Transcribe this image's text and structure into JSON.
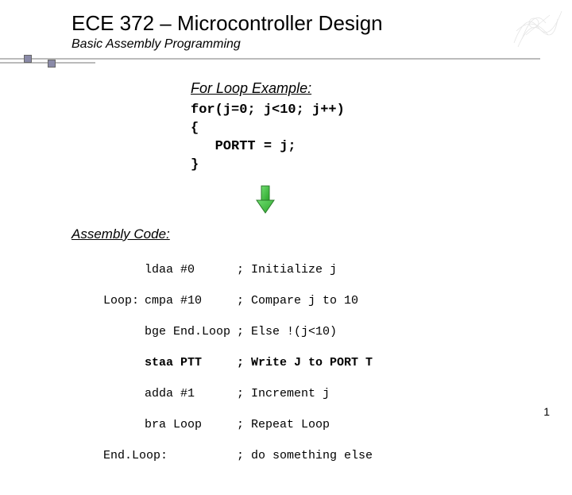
{
  "header": {
    "title": "ECE 372 – Microcontroller Design",
    "subtitle": "Basic Assembly Programming"
  },
  "example": {
    "heading": "For Loop Example:",
    "code_line1": "for(j=0; j<10; j++)",
    "code_line2": "{",
    "code_line3": "   PORTT = j;",
    "code_line4": "}"
  },
  "assembly": {
    "heading": "Assembly Code:",
    "lines": [
      {
        "label": "",
        "instr": "ldaa #0",
        "comment": "; Initialize j"
      },
      {
        "label": "Loop:",
        "instr": "cmpa #10",
        "comment": "; Compare j to 10"
      },
      {
        "label": "",
        "instr": "bge End.Loop",
        "comment": "; Else !(j<10)"
      },
      {
        "label": "",
        "instr": "staa PTT",
        "comment": "; Write J to PORT T"
      },
      {
        "label": "",
        "instr": "adda #1",
        "comment": "; Increment j"
      },
      {
        "label": "",
        "instr": "bra Loop",
        "comment": "; Repeat Loop"
      },
      {
        "label": "End.Loop:",
        "instr": "",
        "comment": "; do something else"
      }
    ]
  },
  "page_number": "1"
}
